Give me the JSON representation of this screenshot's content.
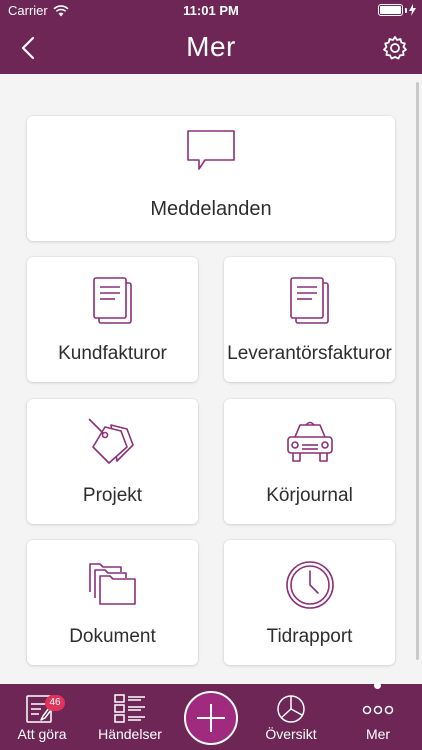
{
  "status": {
    "carrier": "Carrier",
    "time": "11:01 PM"
  },
  "header": {
    "title": "Mer"
  },
  "cards": {
    "messages": "Meddelanden",
    "customer_invoices": "Kundfakturor",
    "supplier_invoices": "Leverantörsfakturor",
    "projects": "Projekt",
    "mileage_log": "Körjournal",
    "documents": "Dokument",
    "time_report": "Tidrapport"
  },
  "tabs": {
    "todo": {
      "label": "Att göra",
      "badge": "46"
    },
    "events": {
      "label": "Händelser"
    },
    "overview": {
      "label": "Översikt"
    },
    "more": {
      "label": "Mer"
    }
  },
  "icons": {
    "messages": "speech-bubble-icon",
    "customer_invoices": "document-stack-icon",
    "supplier_invoices": "document-stack-icon",
    "projects": "price-tag-icon",
    "mileage_log": "car-icon",
    "documents": "folder-stack-icon",
    "time_report": "clock-icon"
  },
  "colors": {
    "brand": "#6e2656",
    "accent": "#a02a7e",
    "icon": "#8e2f78",
    "badge": "#e0335b"
  }
}
